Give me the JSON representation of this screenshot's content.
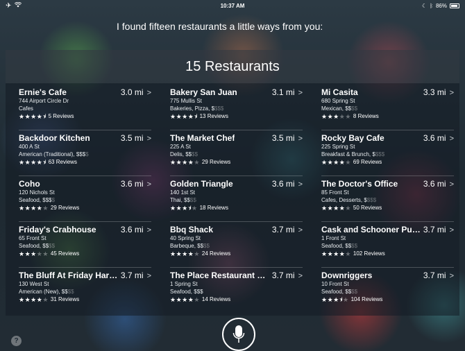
{
  "status_bar": {
    "time": "10:37 AM",
    "battery": "86%",
    "battery_level": 0.86,
    "left_icons": [
      "airplane-icon",
      "wifi-icon"
    ],
    "right_icons": [
      "moon-icon",
      "bluetooth-icon",
      "battery-icon"
    ]
  },
  "siri": {
    "response": "I found fifteen restaurants a little ways from you:"
  },
  "results": {
    "title": "15 Restaurants",
    "restaurants": [
      {
        "name": "Ernie's Cafe",
        "distance": "3.0 mi",
        "address": "744 Airport Circle Dr",
        "category": "Cafes",
        "price_dim": "",
        "stars": 4.5,
        "reviews": "5 Reviews"
      },
      {
        "name": "Bakery San Juan",
        "distance": "3.1 mi",
        "address": "775 Mullis St",
        "category": "Bakeries, Pizza, $",
        "price_dim": "$$$",
        "stars": 4.5,
        "reviews": "13 Reviews"
      },
      {
        "name": "Mi Casita",
        "distance": "3.3 mi",
        "address": "680 Spring St",
        "category": "Mexican, $$",
        "price_dim": "$$",
        "stars": 3,
        "reviews": "8 Reviews"
      },
      {
        "name": "Backdoor Kitchen",
        "distance": "3.5 mi",
        "address": "400 A St",
        "category": "American (Traditional), $$$",
        "price_dim": "$",
        "stars": 4.5,
        "reviews": "63 Reviews"
      },
      {
        "name": "The Market Chef",
        "distance": "3.5 mi",
        "address": "225 A St",
        "category": "Delis, $$",
        "price_dim": "$$",
        "stars": 4,
        "reviews": "29 Reviews"
      },
      {
        "name": "Rocky Bay Cafe",
        "distance": "3.6 mi",
        "address": "225 Spring St",
        "category": "Breakfast & Brunch, $",
        "price_dim": "$$$",
        "stars": 4,
        "reviews": "69 Reviews"
      },
      {
        "name": "Coho",
        "distance": "3.6 mi",
        "address": "120 Nichols St",
        "category": "Seafood, $$$",
        "price_dim": "$",
        "stars": 4,
        "reviews": "29 Reviews"
      },
      {
        "name": "Golden Triangle",
        "distance": "3.6 mi",
        "address": "140 1st St",
        "category": "Thai, $$",
        "price_dim": "$$",
        "stars": 3.5,
        "reviews": "18 Reviews"
      },
      {
        "name": "The Doctor's Office",
        "distance": "3.6 mi",
        "address": "85 Front St",
        "category": "Cafes, Desserts, $",
        "price_dim": "$$$",
        "stars": 4,
        "reviews": "50 Reviews"
      },
      {
        "name": "Friday's Crabhouse",
        "distance": "3.6 mi",
        "address": "65 Front St",
        "category": "Seafood, $$",
        "price_dim": "$$",
        "stars": 3,
        "reviews": "45 Reviews"
      },
      {
        "name": "Bbq Shack",
        "distance": "3.7 mi",
        "address": "40 Spring St",
        "category": "Barbeque, $$",
        "price_dim": "$$",
        "stars": 4,
        "reviews": "24 Reviews"
      },
      {
        "name": "Cask and Schooner Pub…",
        "distance": "3.7 mi",
        "address": "1 Front St",
        "category": "Seafood, $$",
        "price_dim": "$$",
        "stars": 4,
        "reviews": "102 Reviews"
      },
      {
        "name": "The Bluff At Friday Harb…",
        "distance": "3.7 mi",
        "address": "130 West St",
        "category": "American (New), $$",
        "price_dim": "$$",
        "stars": 4,
        "reviews": "31 Reviews"
      },
      {
        "name": "The Place Restaurant &…",
        "distance": "3.7 mi",
        "address": "1 Spring St",
        "category": "Seafood, $$$",
        "price_dim": "",
        "stars": 4,
        "reviews": "14 Reviews"
      },
      {
        "name": "Downriggers",
        "distance": "3.7 mi",
        "address": "10 Front St",
        "category": "Seafood, $$",
        "price_dim": "$$",
        "stars": 3.5,
        "reviews": "104 Reviews"
      }
    ]
  },
  "controls": {
    "mic_icon": "microphone-icon",
    "help_icon": "question-mark-icon",
    "help_label": "?"
  }
}
